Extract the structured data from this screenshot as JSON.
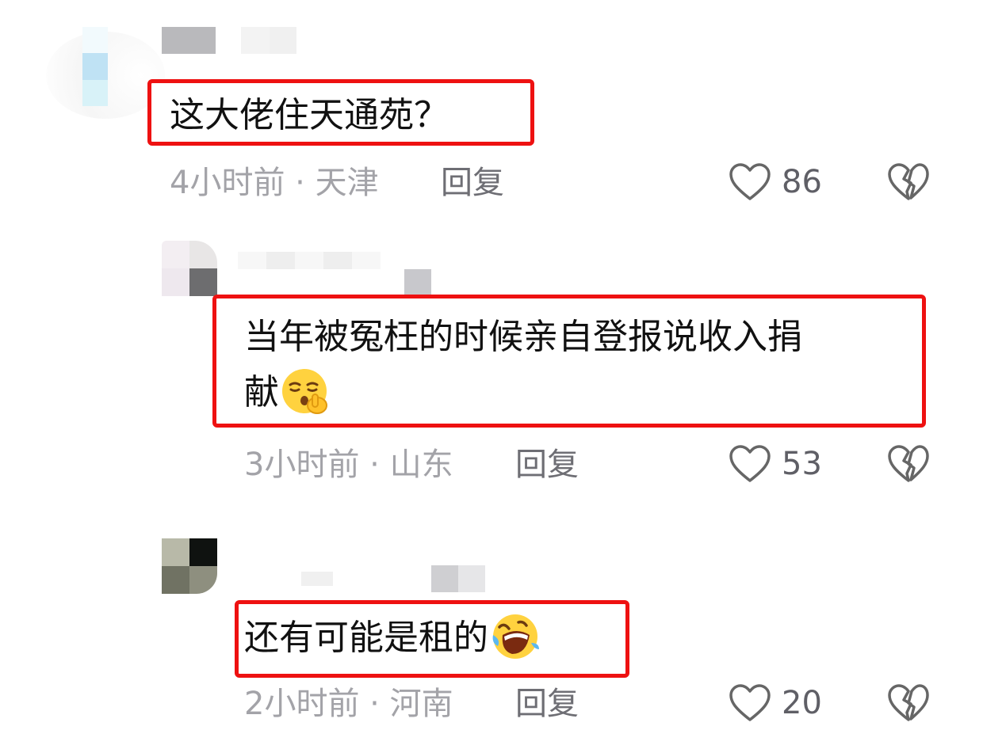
{
  "comments": [
    {
      "text": "这大佬住天通苑？",
      "time_location": "4小时前 · 天津",
      "reply_label": "回复",
      "likes": "86"
    },
    {
      "text_line1": "当年被冤枉的时候亲自登报说收入捐",
      "text_line2": "献",
      "emoji": "shushing-face-emoji",
      "time_location": "3小时前 · 山东",
      "reply_label": "回复",
      "likes": "53"
    },
    {
      "text": "还有可能是租的",
      "emoji": "rolling-on-floor-laughing-emoji",
      "time_location": "2小时前 · 河南",
      "reply_label": "回复",
      "likes": "20"
    }
  ],
  "icons": {
    "like": "heart-outline-icon",
    "dislike": "broken-heart-outline-icon"
  },
  "colors": {
    "highlight_border": "#ee1111",
    "meta_text": "#a3a3a8",
    "reply_text": "#6e6e74",
    "icon_stroke": "#666666"
  }
}
